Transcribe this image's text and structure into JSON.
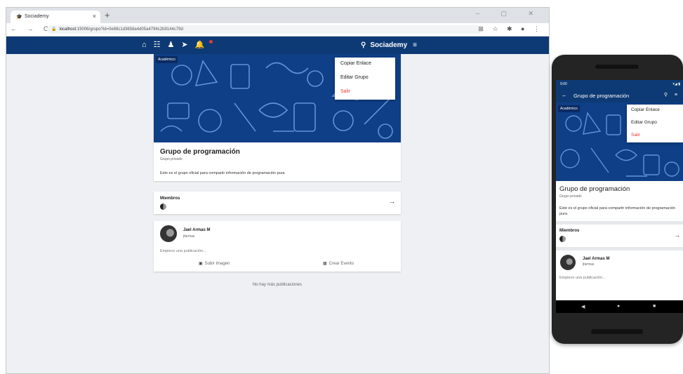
{
  "browser": {
    "tab_title": "Sociademy",
    "tab_close": "×",
    "new_tab": "+",
    "window_controls": "–  ▢  ✕",
    "nav_buttons": "← → C",
    "url_host": "localhost",
    "url_rest": ":19006/grupo?id=0e69c1d3658a4d05a4794c2b9144c79d",
    "ext_icons": "⊞ ☆ ✱ ● ⋮"
  },
  "app": {
    "brand": "Sociademy",
    "nav_icons": [
      "home-icon",
      "groups-icon",
      "person-icon",
      "send-icon",
      "bell-icon"
    ],
    "colors": {
      "primary": "#0d3a74",
      "danger": "#e53935",
      "background": "#eef0f3"
    }
  },
  "group": {
    "badge": "Académico",
    "name": "Grupo de programación",
    "privacy": "Grupo privado",
    "description": "Este es el grupo oficial para compartir información de programación pura"
  },
  "menu": {
    "copy_link": "Copiar Enlace",
    "edit_group": "Editar Grupo",
    "leave": "Salir"
  },
  "members": {
    "label": "Miembros",
    "arrow": "→"
  },
  "post": {
    "author_name": "Jael Armas M",
    "author_handle": "jfarmas",
    "placeholder": "Empiece una publicación...",
    "upload_image": "Subir Imagen",
    "create_event": "Crear Evento"
  },
  "feed": {
    "empty_message": "No hay más publicaciones"
  },
  "phone": {
    "time": "9:00",
    "status_right": "▾◢ ▮",
    "title": "Grupo de programación",
    "back": "←",
    "right_icons": "⚲ ≡",
    "nav_back": "◀",
    "nav_home": "●",
    "nav_recent": "■"
  }
}
